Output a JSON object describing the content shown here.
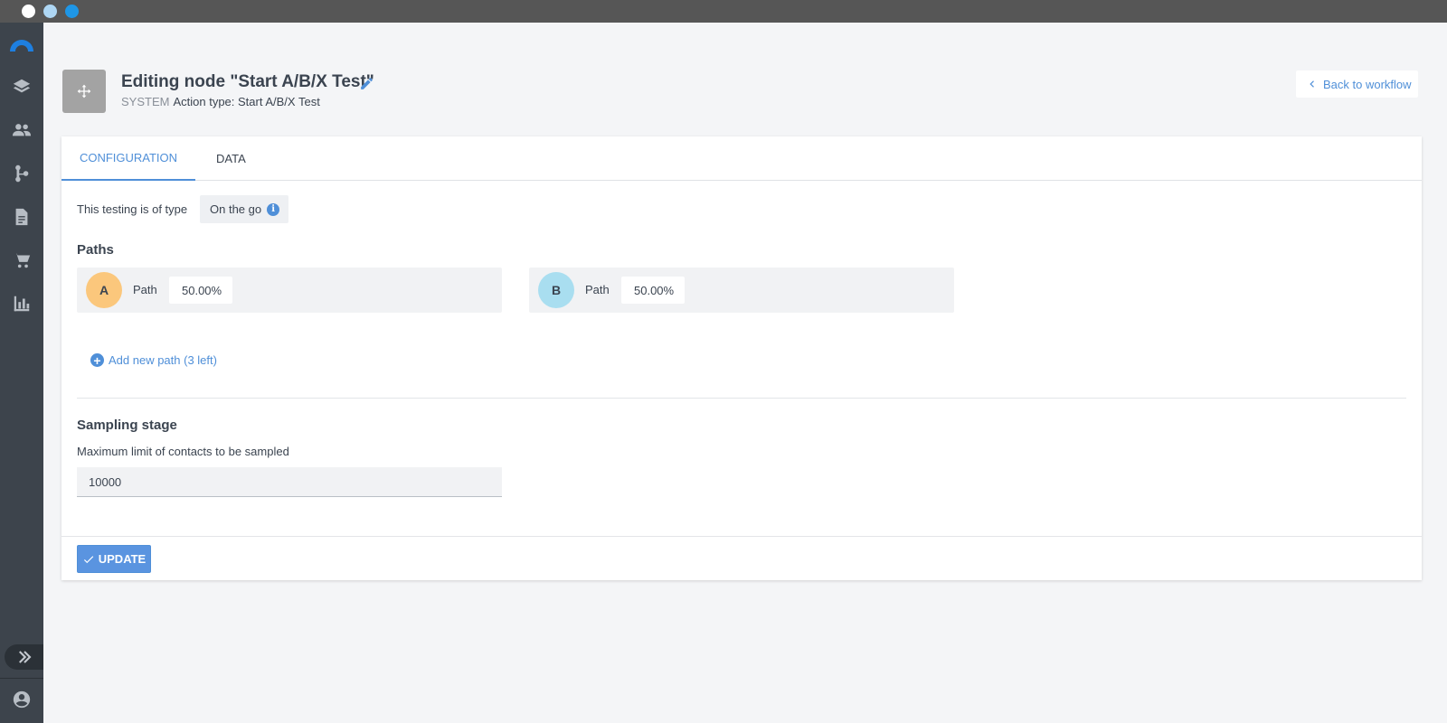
{
  "window": {
    "controls": [
      "close",
      "minimize",
      "maximize"
    ]
  },
  "sidebar": {
    "logo": "brand-arc-icon",
    "items": [
      {
        "icon": "layers-icon"
      },
      {
        "icon": "people-icon"
      },
      {
        "icon": "workflow-icon"
      },
      {
        "icon": "document-icon"
      },
      {
        "icon": "cart-icon"
      },
      {
        "icon": "bar-chart-icon"
      }
    ],
    "expand_icon": "double-chevron-right-icon",
    "user_icon": "user-circle-icon"
  },
  "header": {
    "icon": "move-arrows-icon",
    "title": "Editing node \"Start A/B/X Test\"",
    "system_label": "SYSTEM",
    "action_type": "Action type: Start A/B/X Test",
    "back_label": "Back to workflow"
  },
  "tabs": [
    {
      "label": "CONFIGURATION",
      "active": true
    },
    {
      "label": "DATA",
      "active": false
    }
  ],
  "config": {
    "type_label": "This testing is of type",
    "type_value": "On the go",
    "paths_title": "Paths",
    "paths": [
      {
        "letter": "A",
        "label": "Path",
        "value": "50.00%",
        "color": "#fbc77c"
      },
      {
        "letter": "B",
        "label": "Path",
        "value": "50.00%",
        "color": "#a9def0"
      }
    ],
    "add_path_label": "Add new path (3 left)",
    "sampling_title": "Sampling stage",
    "max_label": "Maximum limit of contacts to be sampled",
    "max_value": "10000"
  },
  "footer": {
    "update_label": "UPDATE"
  },
  "colors": {
    "accent": "#4f8fd8",
    "sidebar": "#3d444c",
    "titlebar": "#565656"
  }
}
